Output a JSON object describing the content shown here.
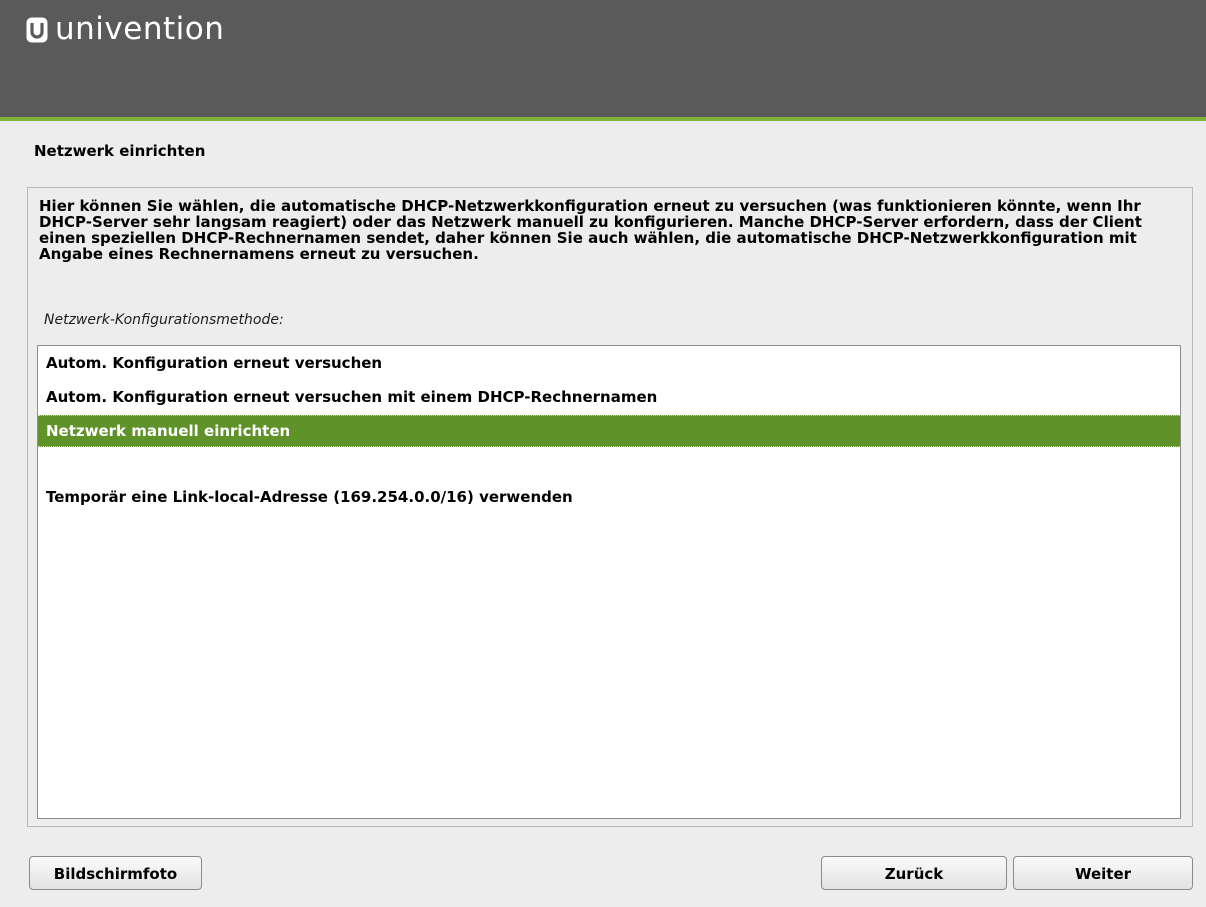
{
  "header": {
    "logo_text": "univention",
    "logo_icon": "univention-logo-icon",
    "accent_color": "#7fb33b",
    "background_color": "#5a5a5a"
  },
  "page": {
    "title": "Netzwerk einrichten"
  },
  "dialog": {
    "description": "Hier können Sie wählen, die automatische DHCP-Netzwerkkonfiguration erneut zu versuchen (was funktionieren könnte, wenn Ihr DHCP-Server sehr langsam reagiert) oder das Netzwerk manuell zu konfigurieren. Manche DHCP-Server erfordern, dass der Client einen speziellen DHCP-Rechnernamen sendet, daher können Sie auch wählen, die automatische DHCP-Netzwerkkonfiguration mit Angabe eines Rechnernamens erneut zu versuchen.",
    "method_label": "Netzwerk-Konfigurationsmethode:",
    "options": [
      {
        "label": "Autom. Konfiguration erneut versuchen",
        "selected": false
      },
      {
        "label": "Autom. Konfiguration erneut versuchen mit einem DHCP-Rechnernamen",
        "selected": false
      },
      {
        "label": "Netzwerk manuell einrichten",
        "selected": true
      },
      {
        "label": "",
        "selected": false
      },
      {
        "label": "Temporär eine Link-local-Adresse (169.254.0.0/16) verwenden",
        "selected": false
      }
    ],
    "selected_color": "#5f9229"
  },
  "buttons": {
    "screenshot": "Bildschirmfoto",
    "back": "Zurück",
    "next": "Weiter"
  }
}
